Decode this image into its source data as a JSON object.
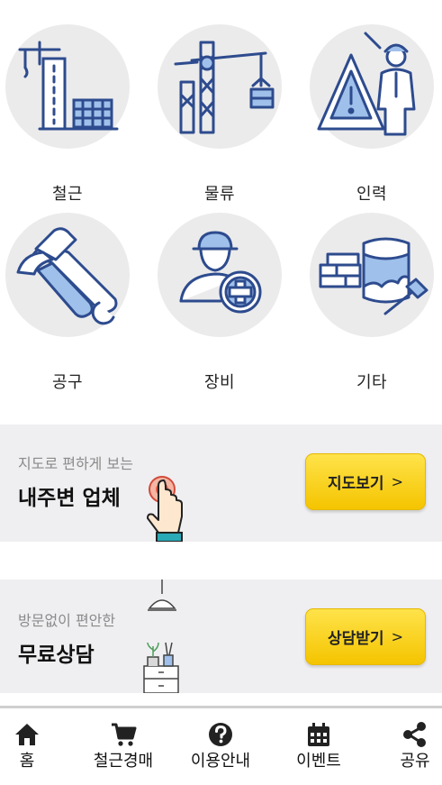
{
  "categories": [
    {
      "label": "철근",
      "icon": "steel-building-icon"
    },
    {
      "label": "물류",
      "icon": "crane-logistics-icon"
    },
    {
      "label": "인력",
      "icon": "worker-warning-icon"
    },
    {
      "label": "공구",
      "icon": "hammer-wrench-icon"
    },
    {
      "label": "장비",
      "icon": "worker-plus-icon"
    },
    {
      "label": "기타",
      "icon": "paint-brick-icon"
    }
  ],
  "map_banner": {
    "subtitle": "지도로 편하게 보는",
    "title": "내주변 업체",
    "button_label": "지도보기",
    "button_chevron": ">"
  },
  "consult_banner": {
    "subtitle": "방문없이 편안한",
    "title": "무료상담",
    "button_label": "상담받기",
    "button_chevron": ">"
  },
  "tabbar": {
    "items": [
      {
        "label": "홈",
        "icon": "home-icon"
      },
      {
        "label": "철근경매",
        "icon": "cart-icon"
      },
      {
        "label": "이용안내",
        "icon": "help-icon"
      },
      {
        "label": "이벤트",
        "icon": "calendar-icon"
      },
      {
        "label": "공유",
        "icon": "share-icon"
      }
    ]
  },
  "colors": {
    "accent_yellow": "#f4c400",
    "icon_blue": "#2d4b8e",
    "icon_light_blue": "#9fc0ea",
    "circle_bg": "#ebebeb",
    "banner_bg": "#efeff1"
  }
}
